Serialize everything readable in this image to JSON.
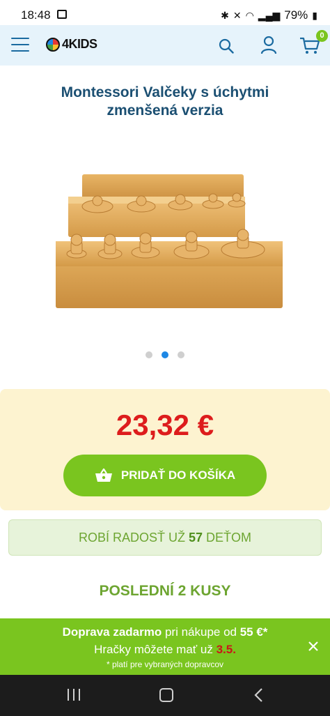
{
  "status_bar": {
    "time": "18:48",
    "battery": "79%"
  },
  "header": {
    "logo_text": "4KIDS",
    "cart_count": "0"
  },
  "product": {
    "title_line1": "Montessori Valčeky s úchytmi",
    "title_line2": "zmenšená verzia",
    "carousel": {
      "count": 3,
      "active_index": 1
    }
  },
  "purchase": {
    "price": "23,32 €",
    "add_to_cart_label": "PRIDAŤ DO KOŠÍKA"
  },
  "social_proof": {
    "text_before": "ROBÍ RADOSŤ UŽ ",
    "count": "57",
    "text_after": " DEŤOM"
  },
  "stock": {
    "label": "POSLEDNÍ 2 KUSY"
  },
  "promo": {
    "line1_bold": "Doprava zadarmo",
    "line1_rest": " pri nákupe od ",
    "line1_amount": "55 €*",
    "line2_text": "Hračky môžete mať už ",
    "line2_date": "3.5.",
    "line3": "* platí pre vybraných dopravcov"
  },
  "colors": {
    "accent_green": "#7ac51f",
    "price_red": "#dd1c1c",
    "title_blue": "#1b4f72",
    "header_bg": "#e6f3fb",
    "price_box_bg": "#fdf3d0"
  }
}
